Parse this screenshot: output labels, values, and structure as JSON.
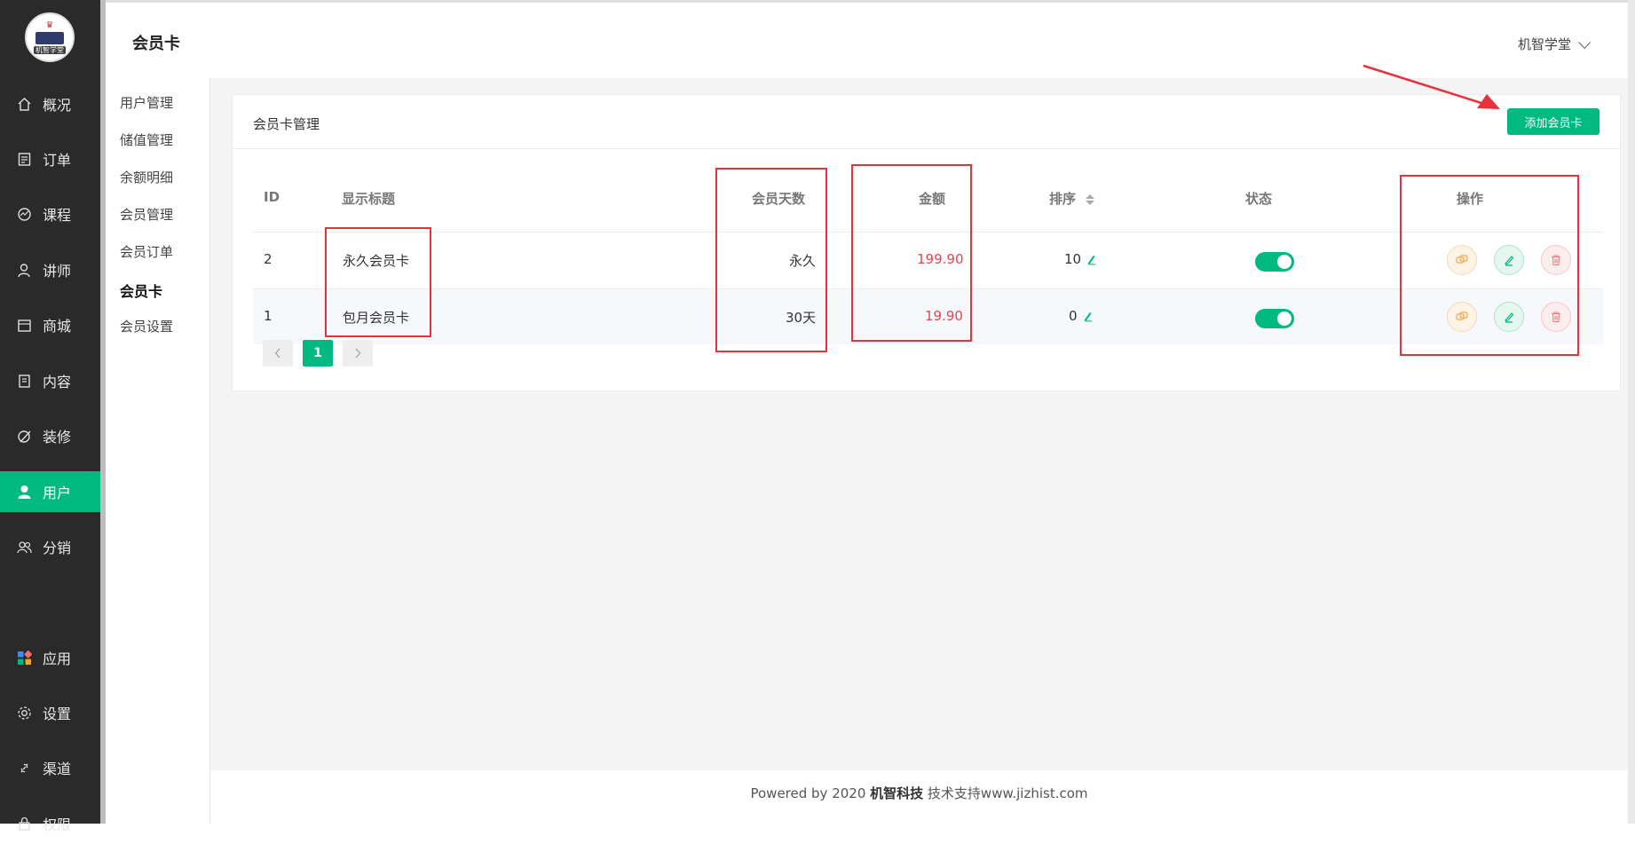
{
  "sidebar": {
    "logo_text": "机智学堂",
    "items": [
      {
        "label": "概况",
        "icon": "home-icon"
      },
      {
        "label": "订单",
        "icon": "order-icon"
      },
      {
        "label": "课程",
        "icon": "course-icon"
      },
      {
        "label": "讲师",
        "icon": "teacher-icon"
      },
      {
        "label": "商城",
        "icon": "store-icon"
      },
      {
        "label": "内容",
        "icon": "content-icon"
      },
      {
        "label": "装修",
        "icon": "decorate-icon"
      },
      {
        "label": "用户",
        "icon": "user-icon"
      },
      {
        "label": "分销",
        "icon": "distribution-icon"
      },
      {
        "label": "应用",
        "icon": "apps-icon"
      },
      {
        "label": "设置",
        "icon": "gear-icon"
      },
      {
        "label": "渠道",
        "icon": "channel-icon"
      },
      {
        "label": "权限",
        "icon": "permission-icon"
      }
    ],
    "active": "用户"
  },
  "submenu": {
    "items": [
      "用户管理",
      "储值管理",
      "余额明细",
      "会员管理",
      "会员订单",
      "会员卡",
      "会员设置"
    ],
    "active": "会员卡"
  },
  "header": {
    "title": "会员卡",
    "user": "机智学堂"
  },
  "card": {
    "title": "会员卡管理",
    "add_button": "添加会员卡"
  },
  "table": {
    "columns": [
      "ID",
      "显示标题",
      "会员天数",
      "金额",
      "排序",
      "状态",
      "操作"
    ],
    "rows": [
      {
        "id": "2",
        "title": "永久会员卡",
        "days": "永久",
        "amount": "199.90",
        "sort": "10",
        "enabled": true
      },
      {
        "id": "1",
        "title": "包月会员卡",
        "days": "30天",
        "amount": "19.90",
        "sort": "0",
        "enabled": true
      }
    ]
  },
  "pager": {
    "current": "1"
  },
  "footer": {
    "prefix": "Powered by 2020 ",
    "company": "机智科技",
    "suffix": " 技术支持www.jizhist.com"
  },
  "colors": {
    "accent": "#00b97f",
    "sidebar_bg": "#2a2a2a",
    "price": "#e8454d",
    "annotation": "#e8323b"
  }
}
